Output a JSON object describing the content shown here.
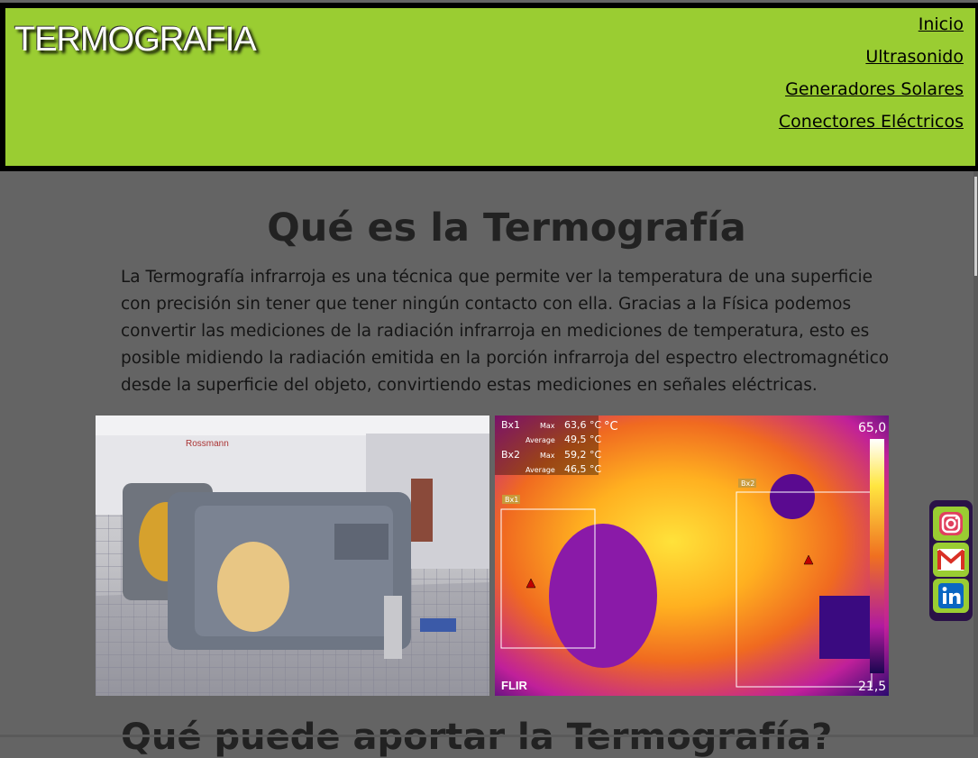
{
  "header": {
    "brand": "TERMOGRAFIA",
    "nav": [
      "Inicio",
      "Ultrasonido",
      "Generadores Solares",
      "Conectores Eléctricos"
    ]
  },
  "main": {
    "title": "Qué es la Termografía",
    "paragraph": "La Termografía infrarroja es una técnica que permite ver la temperatura de una superficie con precisión sin tener que tener ningún contacto con ella. Gracias a la Física podemos convertir las mediciones de la radiación infrarroja en mediciones de temperatura, esto es posible midiendo la radiación emitida en la porción infrarroja del espectro electromagnético desde la superficie del objeto, convirtiendo estas mediciones en señales eléctricas.",
    "next_heading": "Qué puede aportar la Termografía?",
    "photo": {
      "logo_text": "Rossmann"
    },
    "thermal": {
      "bx1": "Bx1",
      "bx1_max": "63,6 °C",
      "bx1_avg": "49,5 °C",
      "bx2": "Bx2",
      "bx2_max": "59,2 °C",
      "bx2_avg": "46,5 °C",
      "max_label": "Max",
      "avg_label": "Average",
      "unit": "°C",
      "scale_max": "65,0",
      "scale_min": "21,5",
      "brand": "FLIR"
    }
  },
  "social": [
    "instagram",
    "gmail",
    "linkedin"
  ],
  "colors": {
    "header_bg": "#9acd32",
    "page_bg": "#646464",
    "social_bg": "#2a1247"
  }
}
